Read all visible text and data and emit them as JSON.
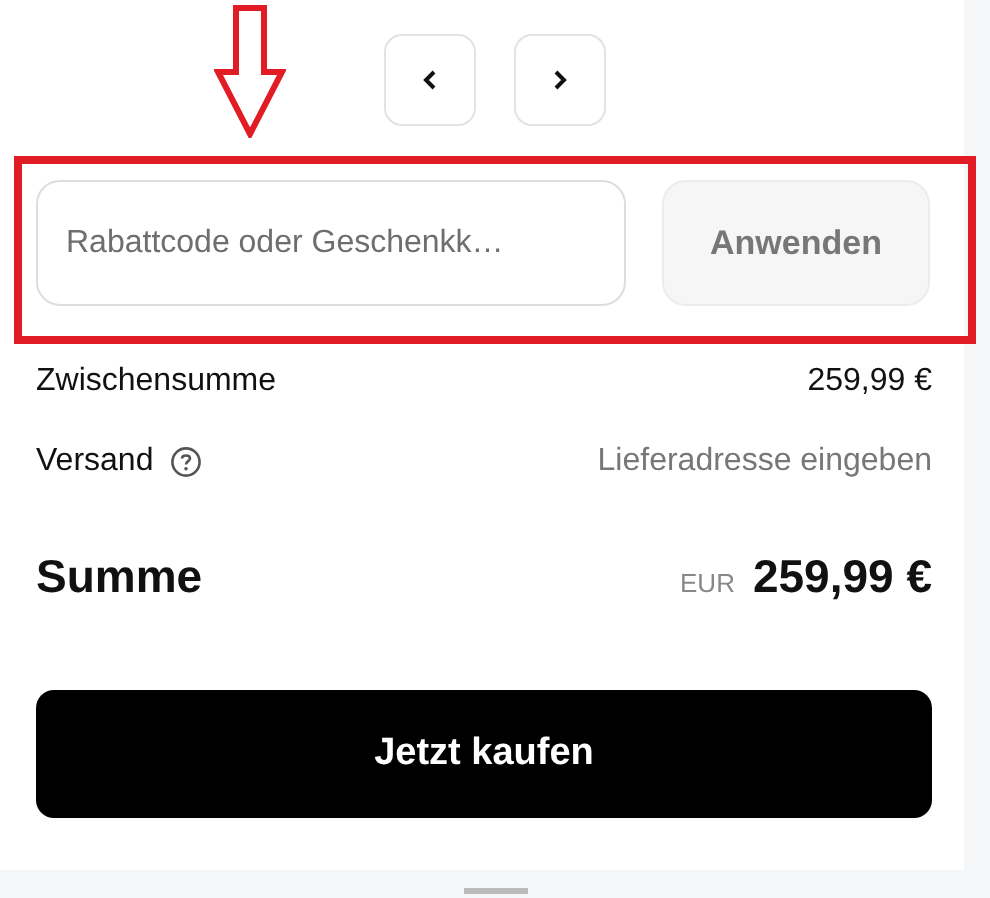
{
  "pager": {
    "buttons": [
      {
        "kind": "prev"
      },
      {
        "kind": "next"
      }
    ]
  },
  "discount": {
    "placeholder": "Rabattcode oder Geschenkk…",
    "apply_button": "Anwenden"
  },
  "summary": {
    "rows": [
      {
        "label": "Zwischensumme",
        "value": "259,99 €",
        "kind": "plain"
      },
      {
        "label": "Versand",
        "value": "Lieferadresse eingeben",
        "kind": "info"
      }
    ],
    "total": {
      "label": "Summe",
      "currency": "EUR",
      "value": "259,99 €"
    }
  },
  "checkout_button": "Jetzt kaufen"
}
